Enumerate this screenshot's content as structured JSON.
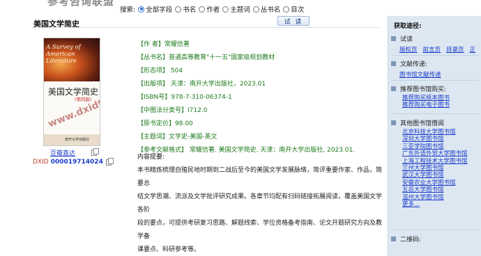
{
  "site": {
    "logo_text": "参考咨询联盟"
  },
  "search": {
    "label": "搜索:",
    "options": [
      "全部字段",
      "书名",
      "作者",
      "主题词",
      "丛书名",
      "目次"
    ],
    "selected": "全部字段"
  },
  "book": {
    "title": "美国文学简史",
    "read_button": "试 读",
    "cover": {
      "english_title": "A Survey of American Literature",
      "chinese_title": "美国文学简史",
      "edition": "(第四版)",
      "watermark": "www.dxidts.com",
      "publisher": "南开大学出版社"
    },
    "trial_link": "豆瓣直达",
    "dxid_label": "DXID",
    "dxid": "000019714024",
    "metadata": [
      "【作    者】常耀信著",
      "【丛书名】普通高等教育\"十一五\"国家级规划教材",
      "【形态项】 504",
      "【出版项】 天津：南开大学出版社，2023.01",
      "【ISBN号】978-7-310-06374-1",
      "【中图法分类号】I712.0",
      "【原书定价】98.00",
      "【主题词】文学史-美国-英文",
      "【参考文献格式】 常耀信著. 美国文学简史. 天津：南开大学出版社, 2023.01."
    ],
    "summary_heading": "内容提要:",
    "summary_lines": [
      "本书精炼梳理自殖民地时期到二战后至今的美国文学发展脉络，简评重要作家、作品，简要总",
      "结文学思潮、流派及文学批评研究成果。各章节均配有扫码链接拓展阅读，覆盖美国文学各阶",
      "段的要点，可提供考研复习思路、解题线索、学位资格备考指南、论文开题研究方向及教学备",
      "课要点、科研参考等。"
    ]
  },
  "sidebar": {
    "heading": "获取途径:",
    "trial": {
      "title": "试读",
      "links": [
        "版权页",
        "前言页",
        "目录页",
        "正"
      ]
    },
    "delivery": {
      "title": "文献传递:",
      "links": [
        "图书馆文献传递"
      ]
    },
    "purchase": {
      "title": "推荐图书馆购买:",
      "links": [
        "推荐购买纸本图书",
        "推荐购买电子图书"
      ]
    },
    "borrow": {
      "title": "其他图书馆借阅",
      "links": [
        "北京科技大学图书馆",
        "深圳大学图书馆",
        "三亚学院图书馆",
        "广东外语外贸大学图书馆",
        "上海工程技术大学图书馆",
        "兰州大学图书馆",
        "武汉大学图书馆",
        "安徽农业大学图书馆",
        "五邑大学图书馆",
        "温州大学图书馆",
        "更多..."
      ]
    },
    "qrcode": {
      "title": "二维码:"
    }
  }
}
